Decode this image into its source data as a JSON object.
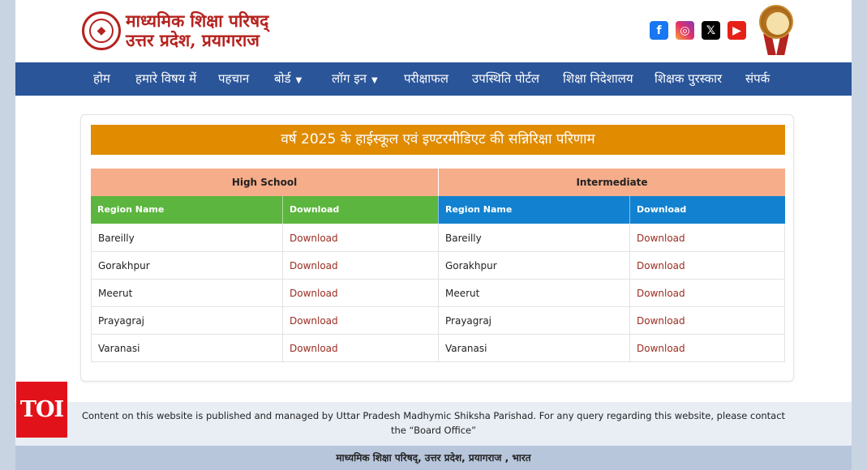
{
  "header": {
    "logo_line1": "माध्यमिक शिक्षा परिषद्",
    "logo_line2": "उत्तर प्रदेश, प्रयागराज",
    "socials": [
      {
        "name": "facebook",
        "glyph": "f"
      },
      {
        "name": "instagram",
        "glyph": "◎"
      },
      {
        "name": "x",
        "glyph": "𝕏"
      },
      {
        "name": "youtube",
        "glyph": "▶"
      }
    ]
  },
  "nav": {
    "items": [
      {
        "label": "होम",
        "dropdown": false
      },
      {
        "label": "हमारे विषय में",
        "dropdown": false
      },
      {
        "label": "पहचान",
        "dropdown": false
      },
      {
        "label": "बोर्ड",
        "dropdown": true
      },
      {
        "label": "लॉग इन",
        "dropdown": true
      },
      {
        "label": "परीक्षाफल",
        "dropdown": false
      },
      {
        "label": "उपस्थिति पोर्टल",
        "dropdown": false
      },
      {
        "label": "शिक्षा निदेशालय",
        "dropdown": false
      },
      {
        "label": "शिक्षक पुरस्कार",
        "dropdown": false
      },
      {
        "label": "संपर्क",
        "dropdown": false
      }
    ]
  },
  "banner": {
    "title": "वर्ष 2025 के हाईस्कूल एवं इण्टरमीडिएट की सन्निरिक्षा परिणाम"
  },
  "table": {
    "groups": [
      "High School",
      "Intermediate"
    ],
    "headers": [
      "Region Name",
      "Download",
      "Region Name",
      "Download"
    ],
    "rows": [
      [
        "Bareilly",
        "Download",
        "Bareilly",
        "Download"
      ],
      [
        "Gorakhpur",
        "Download",
        "Gorakhpur",
        "Download"
      ],
      [
        "Meerut",
        "Download",
        "Meerut",
        "Download"
      ],
      [
        "Prayagraj",
        "Download",
        "Prayagraj",
        "Download"
      ],
      [
        "Varanasi",
        "Download",
        "Varanasi",
        "Download"
      ]
    ]
  },
  "footer": {
    "notice": "Content on this website is published and managed by Uttar Pradesh Madhymic Shiksha Parishad. For any query regarding this website, please contact the “Board Office”",
    "address": "माध्यमिक शिक्षा परिषद्, उत्तर प्रदेश, प्रयागराज , भारत"
  },
  "watermark": "TOI",
  "colors": {
    "nav_bg": "#2a5599",
    "banner_bg": "#e08b00",
    "group_bg": "#f6ad8a",
    "high_school_header": "#5cb53e",
    "intermediate_header": "#1282d0",
    "download_link": "#9b2c20",
    "brand_red": "#b5231f"
  }
}
